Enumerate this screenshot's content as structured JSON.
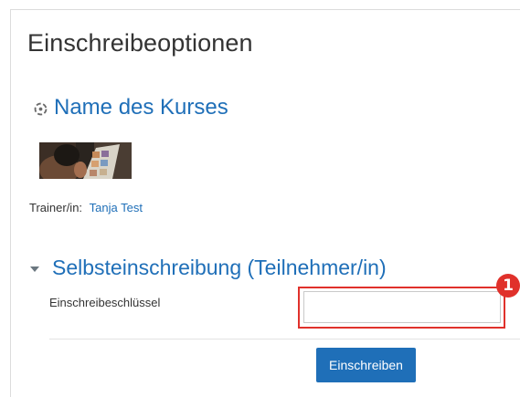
{
  "page": {
    "title": "Einschreibeoptionen"
  },
  "course": {
    "name": "Name des Kurses",
    "icon": "course-icon",
    "teacher_label": "Trainer/in:",
    "teacher_name": "Tanja Test"
  },
  "enrolment_section": {
    "title": "Selbsteinschreibung (Teilnehmer/in)",
    "key_field_label": "Einschreibeschlüssel",
    "key_field_value": "",
    "submit_label": "Einschreiben",
    "callout_number": "1"
  },
  "colors": {
    "link": "#1f6fb8",
    "highlight": "#e0312b",
    "button": "#1f6fb8"
  }
}
